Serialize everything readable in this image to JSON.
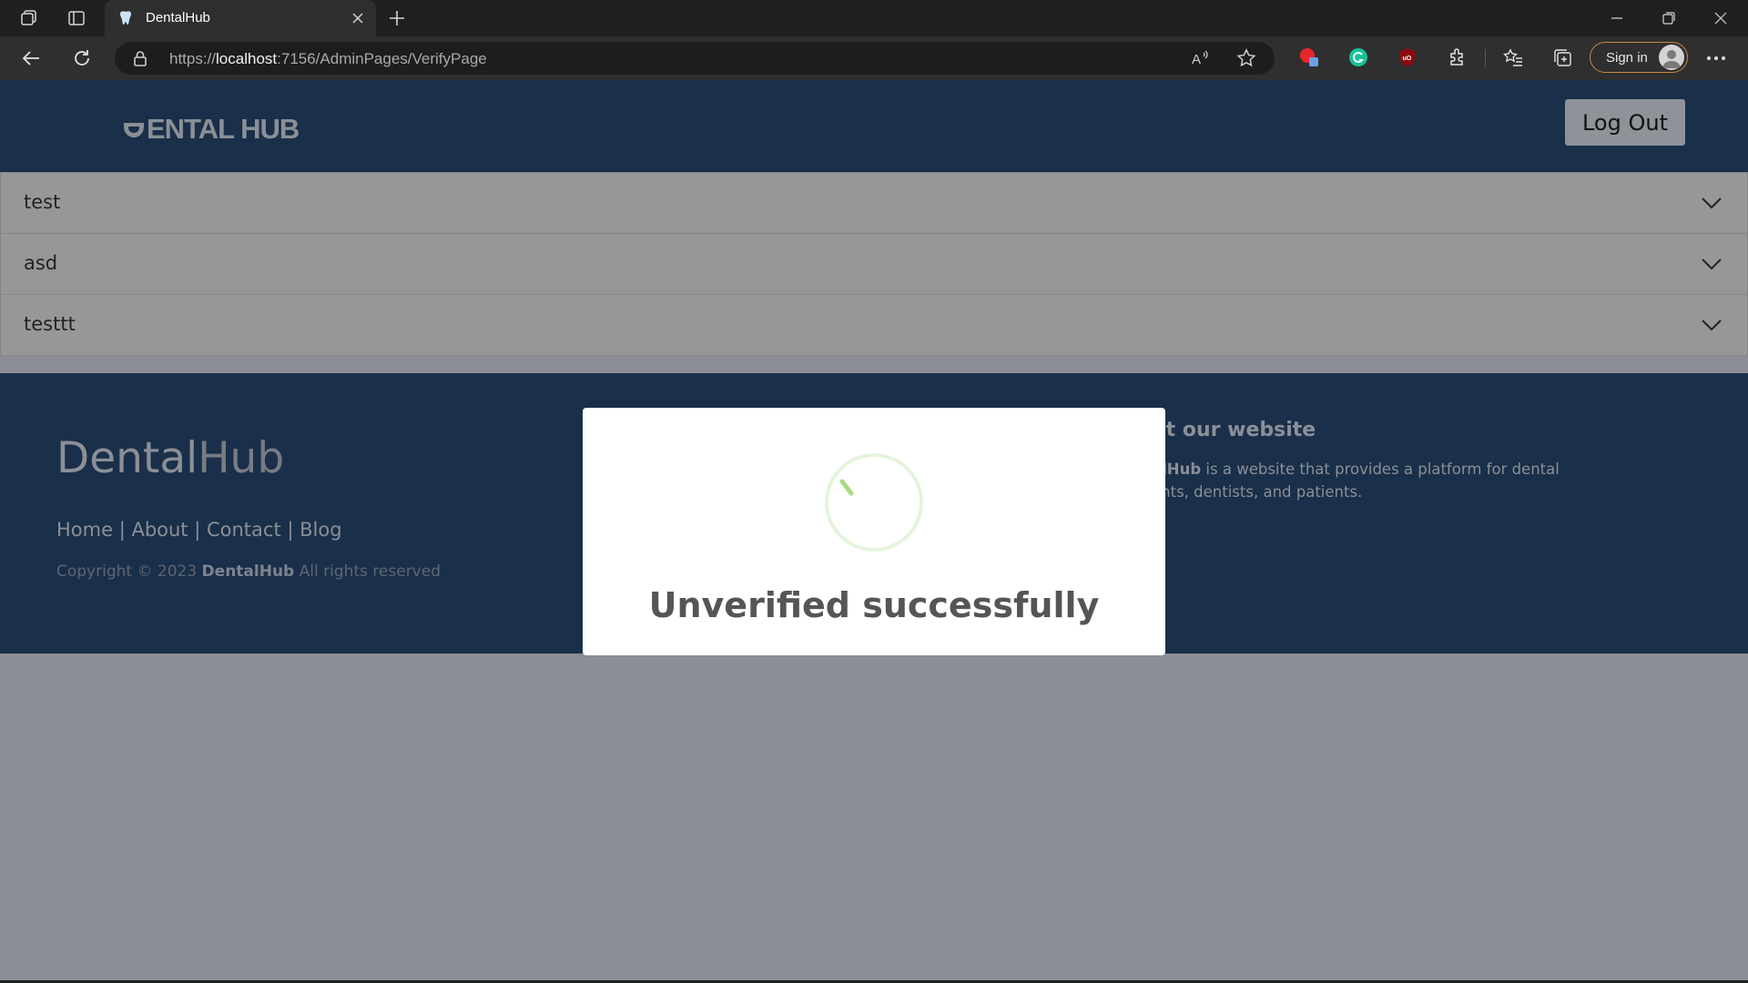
{
  "browser": {
    "tab_title": "DentalHub",
    "url_prefix": "https://",
    "url_host": "localhost",
    "url_rest": ":7156/AdminPages/VerifyPage",
    "sign_in_label": "Sign in",
    "icons": [
      "workspaces-icon",
      "tab-actions-icon",
      "tooth-favicon-icon",
      "close-icon",
      "new-tab-icon",
      "minimize-icon",
      "restore-icon",
      "window-close-icon",
      "back-icon",
      "refresh-icon",
      "lock-icon",
      "read-aloud-icon",
      "favorite-star-icon",
      "extension-red-icon",
      "grammarly-icon",
      "ublock-icon",
      "extensions-icon",
      "favorites-icon",
      "collections-icon",
      "profile-icon",
      "more-icon"
    ]
  },
  "header": {
    "logo_text": "ENTAL HUB",
    "logout_label": "Log Out"
  },
  "accordion": {
    "items": [
      {
        "label": "test"
      },
      {
        "label": "asd"
      },
      {
        "label": "testtt"
      }
    ]
  },
  "footer": {
    "logo_part1": "Dental",
    "logo_part2": "Hub",
    "links": [
      "Home",
      "About",
      "Contact",
      "Blog"
    ],
    "separator": " | ",
    "copyright_prefix": "Copyright © 2023 ",
    "copyright_brand": "DentalHub",
    "copyright_suffix": " All rights reserved",
    "about_title": "ut our website",
    "about_brand": "alHub",
    "about_line1": " is a website that provides a platform for dental",
    "about_line2": "ents, dentists, and patients."
  },
  "modal": {
    "title": "Unverified successfully"
  },
  "colors": {
    "header_bg": "#1a2f49",
    "page_bg": "#8b8e96",
    "accordion_bg": "#979797",
    "spinner_green": "#a5dc86"
  }
}
